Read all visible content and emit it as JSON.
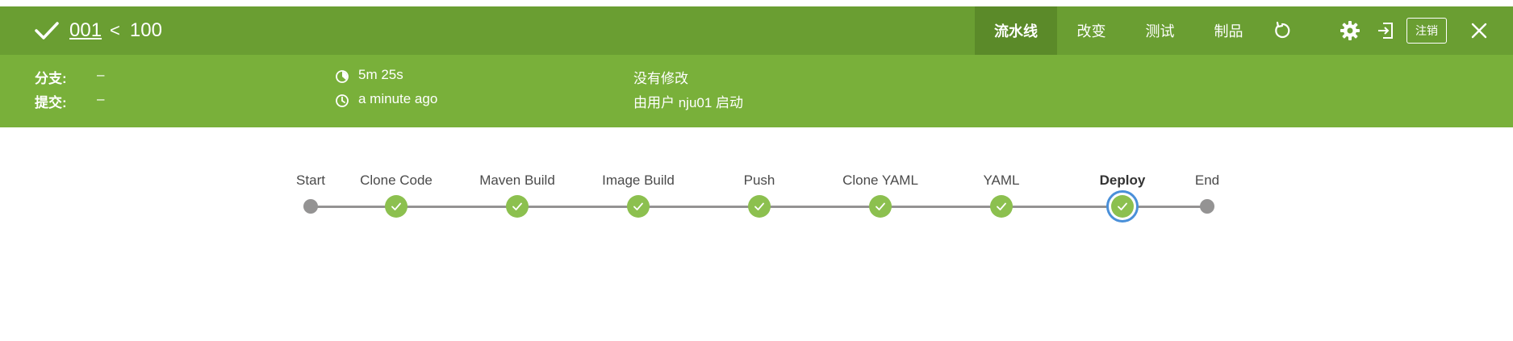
{
  "colors": {
    "header": "#6a9e32",
    "subheader": "#79b03a",
    "tab_active": "#5b8a29",
    "success": "#8cc04f",
    "selected_ring": "#4a90d9",
    "line": "#949393"
  },
  "header": {
    "status_icon": "check-icon",
    "run_number": "001",
    "separator": "<",
    "total": "100",
    "tabs": [
      {
        "label": "流水线",
        "active": true
      },
      {
        "label": "改变",
        "active": false
      },
      {
        "label": "测试",
        "active": false
      },
      {
        "label": "制品",
        "active": false
      }
    ],
    "icons": [
      "replay-icon",
      "gear-icon",
      "exit-icon",
      "close-icon"
    ],
    "logout_label": "注销"
  },
  "meta": {
    "branch_label": "分支:",
    "branch_value": "–",
    "commit_label": "提交:",
    "commit_value": "–",
    "duration": "5m 25s",
    "started": "a minute ago",
    "changes": "没有修改",
    "cause": "由用户 nju01 启动"
  },
  "pipeline": {
    "stages": [
      {
        "name": "Start",
        "type": "start"
      },
      {
        "name": "Clone Code",
        "type": "success"
      },
      {
        "name": "Maven Build",
        "type": "success"
      },
      {
        "name": "Image Build",
        "type": "success"
      },
      {
        "name": "Push",
        "type": "success"
      },
      {
        "name": "Clone YAML",
        "type": "success"
      },
      {
        "name": "YAML",
        "type": "success"
      },
      {
        "name": "Deploy",
        "type": "selected"
      },
      {
        "name": "End",
        "type": "end"
      }
    ]
  }
}
